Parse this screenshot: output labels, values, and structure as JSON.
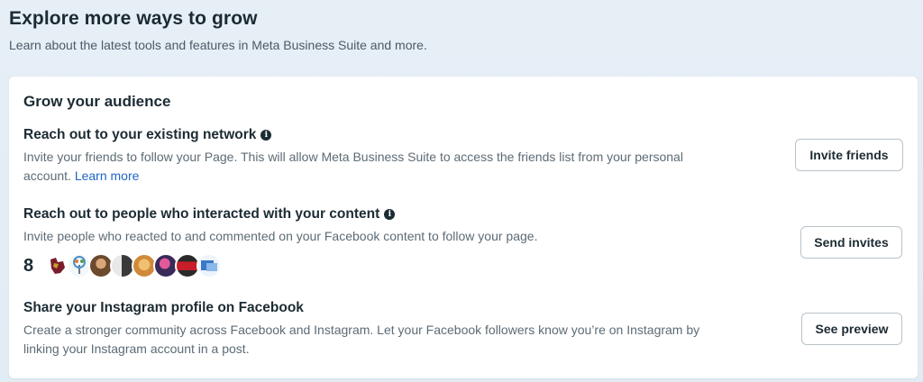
{
  "header": {
    "title": "Explore more ways to grow",
    "subtitle": "Learn about the latest tools and features in Meta Business Suite and more."
  },
  "card": {
    "title": "Grow your audience",
    "sections": [
      {
        "title": "Reach out to your existing network",
        "desc": "Invite your friends to follow your Page. This will allow Meta Business Suite to access the friends list from your personal account.",
        "link": "Learn more",
        "button": "Invite friends"
      },
      {
        "title": "Reach out to people who interacted with your content",
        "desc": "Invite people who reacted to and commented on your Facebook content to follow your page.",
        "count": "8",
        "button": "Send invites"
      },
      {
        "title": "Share your Instagram profile on Facebook",
        "desc": "Create a stronger community across Facebook and Instagram. Let your Facebook followers know you’re on Instagram by linking your Instagram account in a post.",
        "button": "See preview"
      }
    ]
  },
  "info_icon": "i",
  "colors": {
    "link": "#1e64c8",
    "text": "#1c2b33",
    "muted": "#5d6b75"
  }
}
